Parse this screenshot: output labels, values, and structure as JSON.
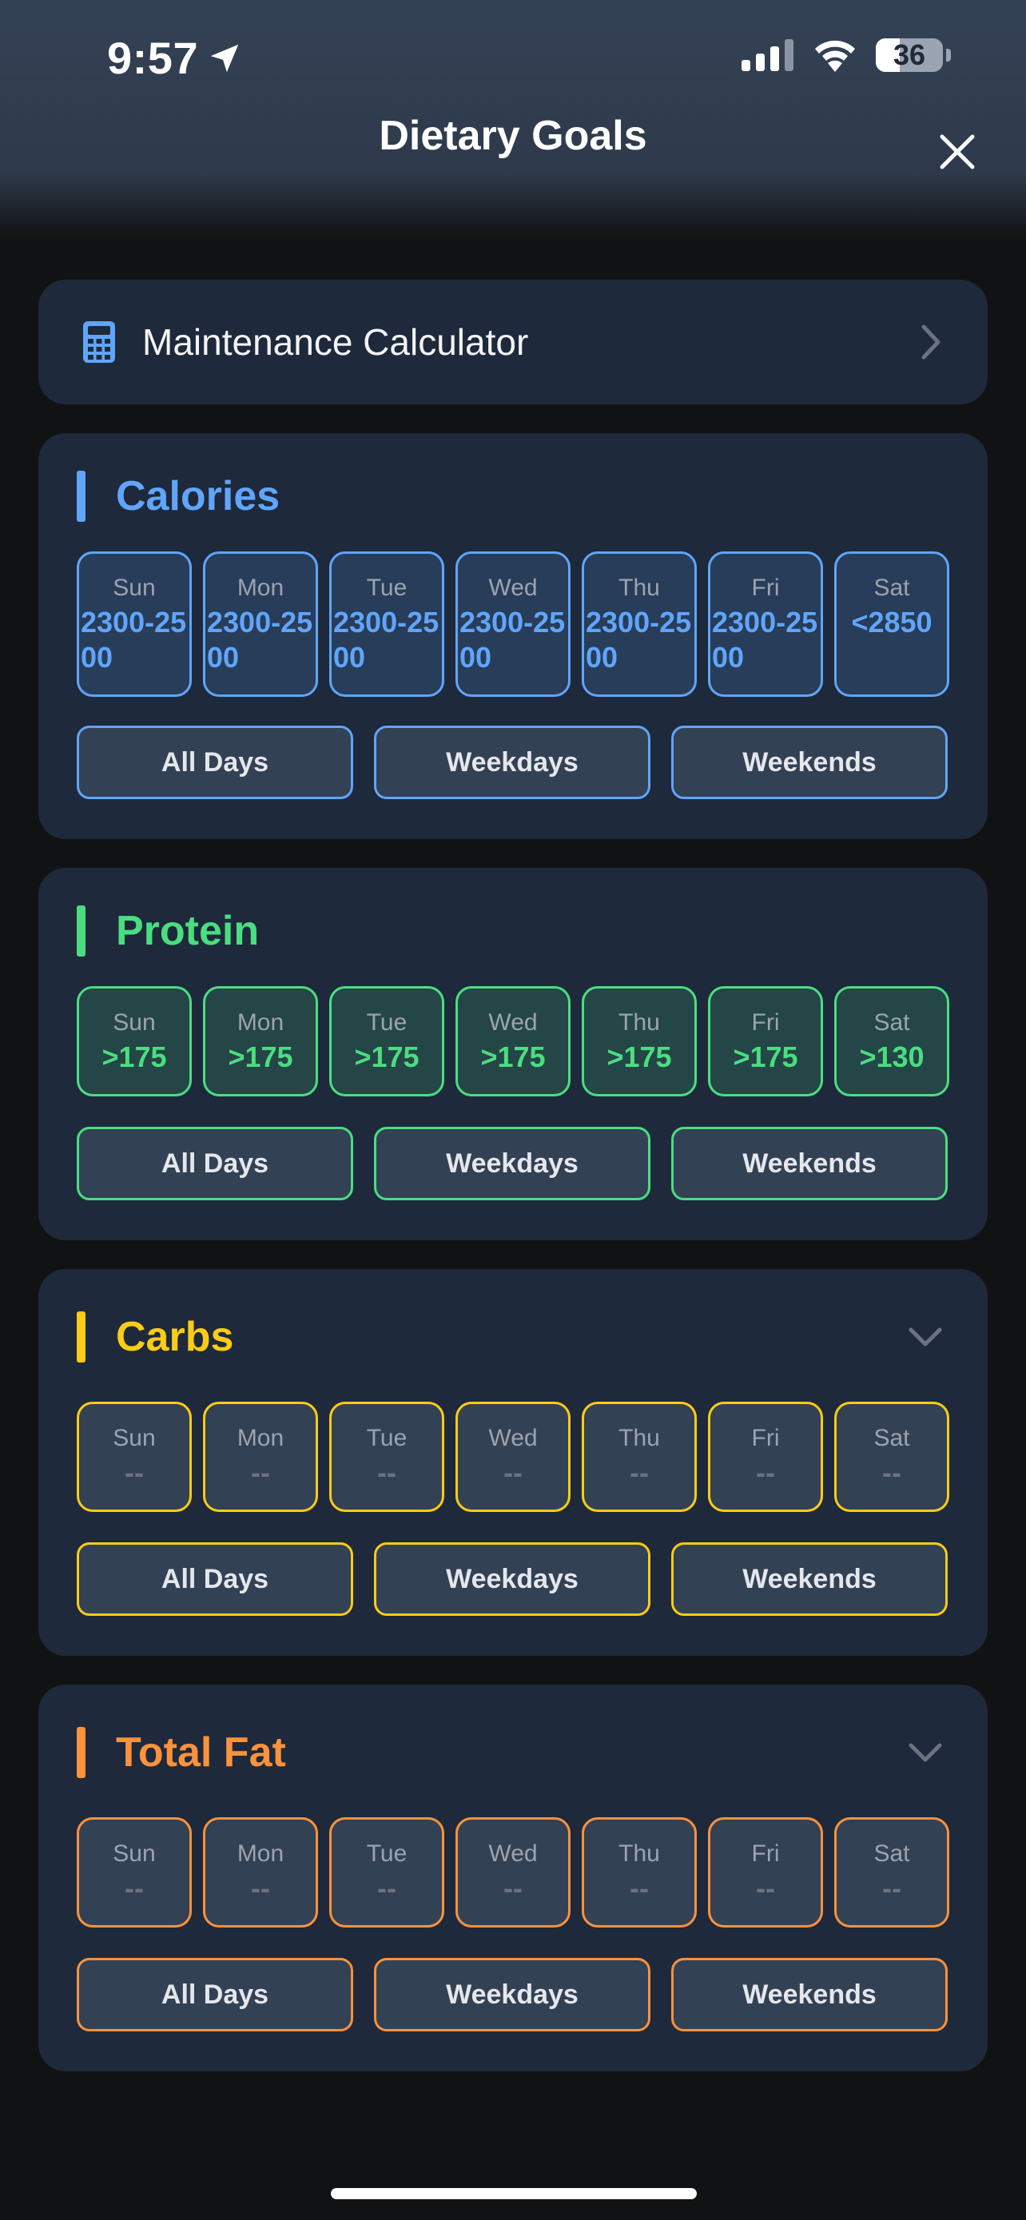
{
  "status_bar": {
    "time": "9:57",
    "battery": "36"
  },
  "header": {
    "title": "Dietary Goals"
  },
  "calculator": {
    "label": "Maintenance Calculator"
  },
  "sections": [
    {
      "title": "Calories",
      "color": "#60a5fa",
      "collapsed_chevron": false,
      "days": [
        {
          "name": "Sun",
          "value": "2300-2500"
        },
        {
          "name": "Mon",
          "value": "2300-2500"
        },
        {
          "name": "Tue",
          "value": "2300-2500"
        },
        {
          "name": "Wed",
          "value": "2300-2500"
        },
        {
          "name": "Thu",
          "value": "2300-2500"
        },
        {
          "name": "Fri",
          "value": "2300-2500"
        },
        {
          "name": "Sat",
          "value": "<2850"
        }
      ],
      "presets": [
        "All Days",
        "Weekdays",
        "Weekends"
      ]
    },
    {
      "title": "Protein",
      "color": "#4ade80",
      "collapsed_chevron": false,
      "days": [
        {
          "name": "Sun",
          "value": ">175"
        },
        {
          "name": "Mon",
          "value": ">175"
        },
        {
          "name": "Tue",
          "value": ">175"
        },
        {
          "name": "Wed",
          "value": ">175"
        },
        {
          "name": "Thu",
          "value": ">175"
        },
        {
          "name": "Fri",
          "value": ">175"
        },
        {
          "name": "Sat",
          "value": ">130"
        }
      ],
      "presets": [
        "All Days",
        "Weekdays",
        "Weekends"
      ]
    },
    {
      "title": "Carbs",
      "color": "#facc15",
      "collapsed_chevron": true,
      "days": [
        {
          "name": "Sun",
          "value": "--"
        },
        {
          "name": "Mon",
          "value": "--"
        },
        {
          "name": "Tue",
          "value": "--"
        },
        {
          "name": "Wed",
          "value": "--"
        },
        {
          "name": "Thu",
          "value": "--"
        },
        {
          "name": "Fri",
          "value": "--"
        },
        {
          "name": "Sat",
          "value": "--"
        }
      ],
      "presets": [
        "All Days",
        "Weekdays",
        "Weekends"
      ]
    },
    {
      "title": "Total Fat",
      "color": "#fb923c",
      "collapsed_chevron": true,
      "days": [
        {
          "name": "Sun",
          "value": "--"
        },
        {
          "name": "Mon",
          "value": "--"
        },
        {
          "name": "Tue",
          "value": "--"
        },
        {
          "name": "Wed",
          "value": "--"
        },
        {
          "name": "Thu",
          "value": "--"
        },
        {
          "name": "Fri",
          "value": "--"
        },
        {
          "name": "Sat",
          "value": "--"
        }
      ],
      "presets": [
        "All Days",
        "Weekdays",
        "Weekends"
      ]
    }
  ],
  "icons": {
    "location": "location-arrow-icon",
    "signal": "cellular-signal-icon",
    "wifi": "wifi-icon",
    "battery": "battery-icon",
    "close": "close-icon",
    "calculator": "calculator-icon",
    "chevron_right": "chevron-right-icon",
    "chevron_down": "chevron-down-icon"
  }
}
